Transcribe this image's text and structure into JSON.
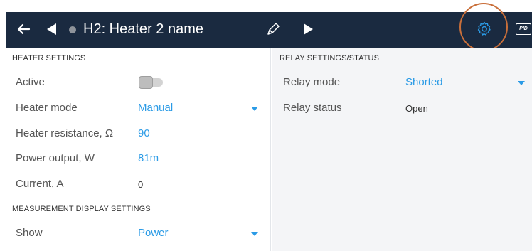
{
  "header": {
    "title": "H2: Heater 2 name",
    "pid_label": "PID"
  },
  "heater_settings": {
    "section_title": "HEATER SETTINGS",
    "active_label": "Active",
    "active_on": false,
    "mode_label": "Heater mode",
    "mode_value": "Manual",
    "resistance_label": "Heater resistance, Ω",
    "resistance_value": "90",
    "power_label": "Power output, W",
    "power_value": "81m",
    "current_label": "Current, A",
    "current_value": "0"
  },
  "measurement_display": {
    "section_title": "MEASUREMENT DISPLAY SETTINGS",
    "show_label": "Show",
    "show_value": "Power"
  },
  "relay": {
    "section_title": "RELAY SETTINGS/STATUS",
    "mode_label": "Relay mode",
    "mode_value": "Shorted",
    "status_label": "Relay status",
    "status_value": "Open"
  },
  "colors": {
    "header_bg": "#1a2a40",
    "accent": "#2b9be6",
    "highlight_ring": "#c96f3a"
  }
}
